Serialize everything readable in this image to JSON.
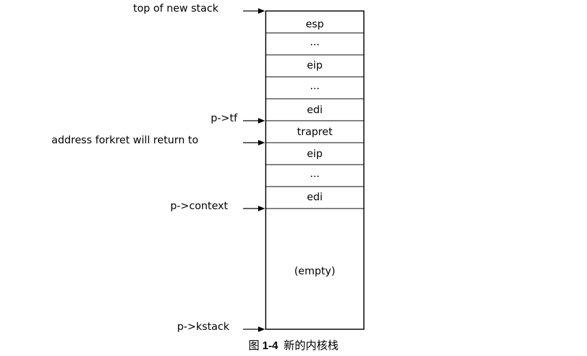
{
  "labels": {
    "top_of_stack": "top of new stack",
    "tf": "p->tf",
    "forkret": "address forkret will return to",
    "context": "p->context",
    "kstack": "p->kstack"
  },
  "cells": [
    "esp",
    "...",
    "eip",
    "...",
    "edi",
    "trapret",
    "eip",
    "...",
    "edi"
  ],
  "empty_label": "(empty)",
  "caption": {
    "prefix": "图",
    "number": "1-4",
    "text": "新的内核栈"
  }
}
